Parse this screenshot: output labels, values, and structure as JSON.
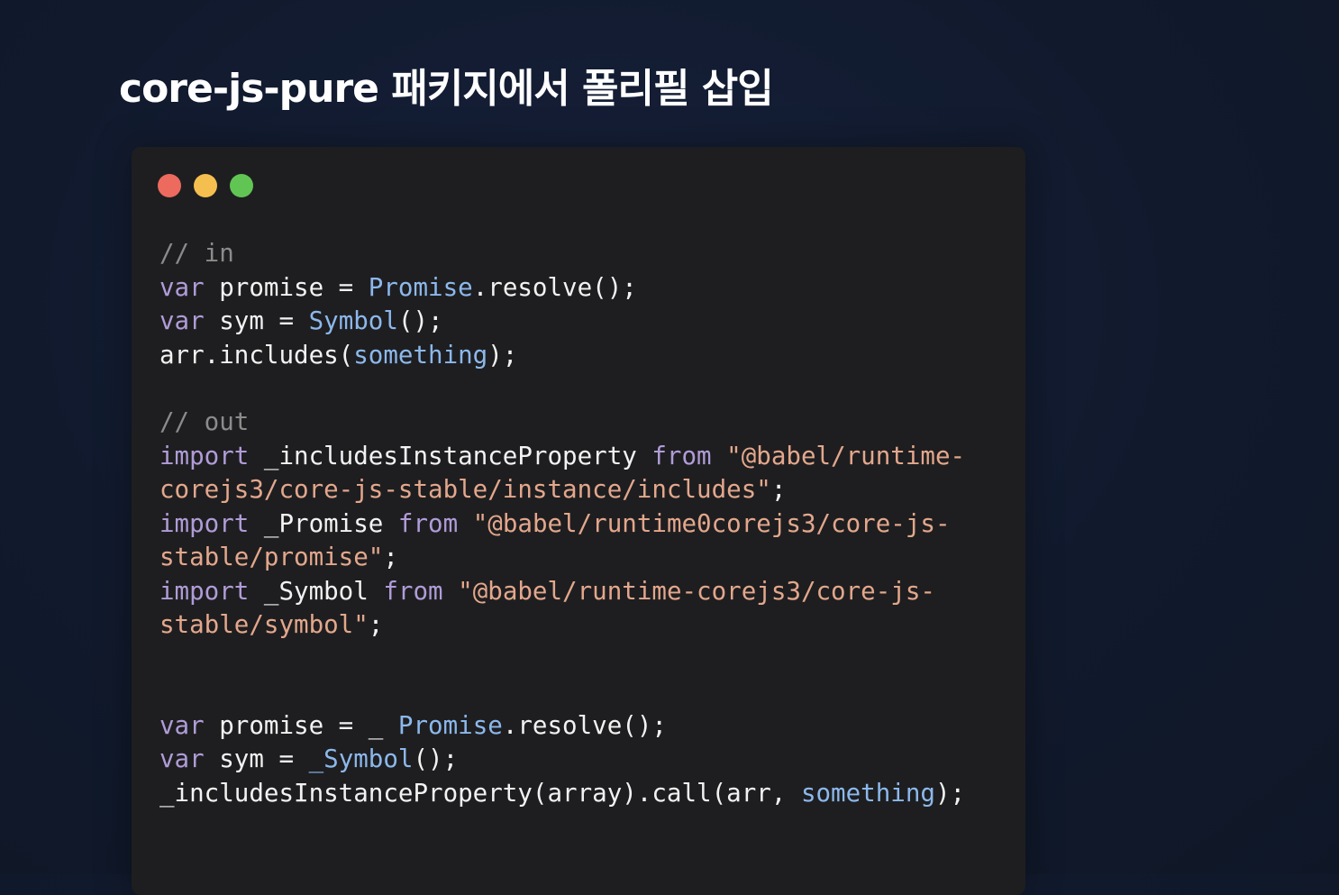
{
  "title": "core-js-pure 패키지에서 폴리필 삽입",
  "window_dots": [
    "red",
    "yellow",
    "green"
  ],
  "colors": {
    "background": "#111a2d",
    "code_bg": "#1e1e20",
    "comment": "#8b8b8b",
    "keyword": "#b09cd8",
    "type": "#8cb8ec",
    "string": "#e3a78c",
    "plain": "#f2f2f2"
  },
  "code": {
    "comment_in": "// in",
    "in_lines": [
      {
        "kw": "var",
        "name": " promise = ",
        "type": "Promise",
        "rest": ".resolve();"
      },
      {
        "kw": "var",
        "name": " sym = ",
        "type": "Symbol",
        "rest": "();"
      }
    ],
    "in_includes": {
      "obj": "arr.includes(",
      "arg": "something",
      "rest": ");"
    },
    "comment_out": "// out",
    "imports": [
      {
        "kw": "import",
        "name": " _includesInstanceProperty ",
        "from": "from",
        "str_line1": " \"@babel/runtime-",
        "str_line2": "corejs3/core-js-stable/instance/includes\"",
        "end": ";"
      },
      {
        "kw": "import",
        "name": " _Promise ",
        "from": "from",
        "str_line1": " \"@babel/runtime0corejs3/core-js-",
        "str_line2": "stable/promise\"",
        "end": ";"
      },
      {
        "kw": "import",
        "name": " _Symbol ",
        "from": "from",
        "str_line1": " \"@babel/runtime-corejs3/core-js-",
        "str_line2": "stable/symbol\"",
        "end": ";"
      }
    ],
    "out_lines": [
      {
        "kw": "var",
        "name": " promise = _ ",
        "type": "Promise",
        "rest": ".resolve();"
      },
      {
        "kw": "var",
        "name": " sym = ",
        "type": "_Symbol",
        "rest": "();"
      }
    ],
    "out_includes": {
      "obj": "_includesInstanceProperty(array).call(arr, ",
      "arg": "something",
      "rest": ");"
    }
  }
}
